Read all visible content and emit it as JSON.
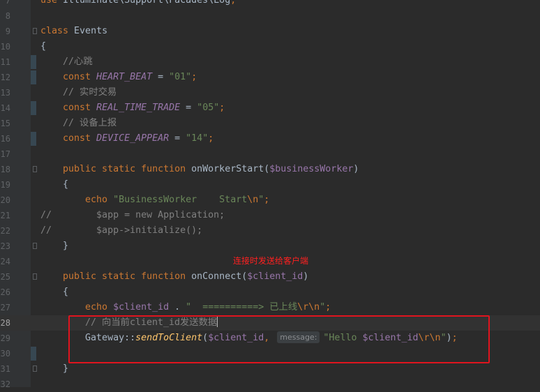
{
  "editor": {
    "lines": [
      {
        "n": "7",
        "t": [
          {
            "c": "kw",
            "s": "use "
          },
          {
            "c": "",
            "s": "Illuminate\\Support\\Facades\\Log"
          },
          {
            "c": "kw",
            "s": ";"
          }
        ]
      },
      {
        "n": "8",
        "t": []
      },
      {
        "n": "9",
        "t": [
          {
            "c": "kw",
            "s": "class "
          },
          {
            "c": "",
            "s": "Events"
          }
        ],
        "fold": true
      },
      {
        "n": "10",
        "t": [
          {
            "c": "",
            "s": "{"
          }
        ]
      },
      {
        "n": "11",
        "t": [
          {
            "c": "cmt",
            "s": "    //心跳"
          }
        ],
        "marker": true
      },
      {
        "n": "12",
        "t": [
          {
            "c": "kw",
            "s": "    const "
          },
          {
            "c": "const",
            "s": "HEART_BEAT"
          },
          {
            "c": "",
            "s": " = "
          },
          {
            "c": "str",
            "s": "\"01\""
          },
          {
            "c": "kw",
            "s": ";"
          }
        ],
        "marker": true
      },
      {
        "n": "13",
        "t": [
          {
            "c": "cmt",
            "s": "    // 实时交易"
          }
        ]
      },
      {
        "n": "14",
        "t": [
          {
            "c": "kw",
            "s": "    const "
          },
          {
            "c": "const",
            "s": "REAL_TIME_TRADE"
          },
          {
            "c": "",
            "s": " = "
          },
          {
            "c": "str",
            "s": "\"05\""
          },
          {
            "c": "kw",
            "s": ";"
          }
        ],
        "marker": true
      },
      {
        "n": "15",
        "t": [
          {
            "c": "cmt",
            "s": "    // 设备上报"
          }
        ]
      },
      {
        "n": "16",
        "t": [
          {
            "c": "kw",
            "s": "    const "
          },
          {
            "c": "const",
            "s": "DEVICE_APPEAR"
          },
          {
            "c": "",
            "s": " = "
          },
          {
            "c": "str",
            "s": "\"14\""
          },
          {
            "c": "kw",
            "s": ";"
          }
        ],
        "marker": true
      },
      {
        "n": "17",
        "t": []
      },
      {
        "n": "18",
        "t": [
          {
            "c": "kw",
            "s": "    public static function "
          },
          {
            "c": "fn",
            "s": "onWorkerStart"
          },
          {
            "c": "",
            "s": "("
          },
          {
            "c": "var",
            "s": "$businessWorker"
          },
          {
            "c": "",
            "s": ")"
          }
        ],
        "fold": true
      },
      {
        "n": "19",
        "t": [
          {
            "c": "",
            "s": "    {"
          }
        ]
      },
      {
        "n": "20",
        "t": [
          {
            "c": "kw",
            "s": "        echo "
          },
          {
            "c": "str",
            "s": "\"BusinessWorker    Start"
          },
          {
            "c": "esc",
            "s": "\\n"
          },
          {
            "c": "str",
            "s": "\""
          },
          {
            "c": "kw",
            "s": ";"
          }
        ]
      },
      {
        "n": "21",
        "t": [
          {
            "c": "cmt",
            "s": "//        $app = new Application;"
          }
        ]
      },
      {
        "n": "22",
        "t": [
          {
            "c": "cmt",
            "s": "//        $app->initialize();"
          }
        ]
      },
      {
        "n": "23",
        "t": [
          {
            "c": "",
            "s": "    }"
          }
        ],
        "fold": true
      },
      {
        "n": "24",
        "t": []
      },
      {
        "n": "25",
        "t": [
          {
            "c": "kw",
            "s": "    public static function "
          },
          {
            "c": "fn",
            "s": "onConnect"
          },
          {
            "c": "",
            "s": "("
          },
          {
            "c": "var",
            "s": "$client_id"
          },
          {
            "c": "",
            "s": ")"
          }
        ],
        "fold": true
      },
      {
        "n": "26",
        "t": [
          {
            "c": "",
            "s": "    {"
          }
        ]
      },
      {
        "n": "27",
        "t": [
          {
            "c": "kw",
            "s": "        echo "
          },
          {
            "c": "var",
            "s": "$client_id"
          },
          {
            "c": "",
            "s": " . "
          },
          {
            "c": "str",
            "s": "\"  ==========> 已上线"
          },
          {
            "c": "esc",
            "s": "\\r\\n"
          },
          {
            "c": "str",
            "s": "\""
          },
          {
            "c": "kw",
            "s": ";"
          }
        ]
      },
      {
        "n": "28",
        "t": [
          {
            "c": "cmt",
            "s": "        // 向当前client_id发送数据"
          },
          {
            "c": "caret",
            "s": ""
          }
        ],
        "current": true
      },
      {
        "n": "29",
        "t": [
          {
            "c": "",
            "s": "        Gateway::"
          },
          {
            "c": "fni",
            "s": "sendToClient"
          },
          {
            "c": "",
            "s": "("
          },
          {
            "c": "var",
            "s": "$client_id"
          },
          {
            "c": "kw",
            "s": ", "
          },
          {
            "c": "hint",
            "s": "message:"
          },
          {
            "c": "str",
            "s": "\"Hello "
          },
          {
            "c": "var",
            "s": "$client_id"
          },
          {
            "c": "esc",
            "s": "\\r\\n"
          },
          {
            "c": "str",
            "s": "\""
          },
          {
            "c": "",
            "s": ")"
          },
          {
            "c": "kw",
            "s": ";"
          }
        ]
      },
      {
        "n": "30",
        "t": [],
        "marker": true
      },
      {
        "n": "31",
        "t": [
          {
            "c": "",
            "s": "    }"
          }
        ],
        "fold": true
      },
      {
        "n": "32",
        "t": []
      }
    ]
  },
  "annotation": {
    "text": "连接时发送给客户端",
    "color": "#ff2020",
    "box_color": "#e0141e"
  },
  "colors": {
    "background": "#2b2b2b",
    "gutter": "#313335",
    "keyword": "#cc7832",
    "string": "#6a8759",
    "variable": "#9876aa",
    "comment": "#808080",
    "method": "#ffc66d"
  }
}
